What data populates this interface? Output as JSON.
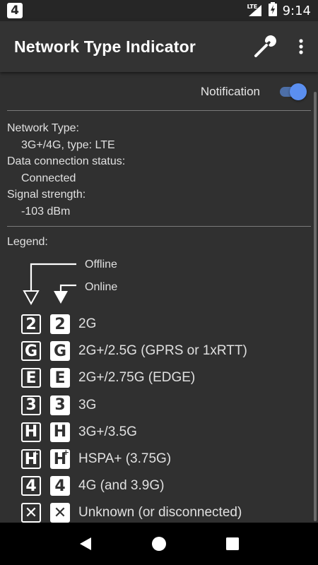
{
  "status_bar": {
    "notification_digit": "4",
    "network_label": "LTE",
    "time": "9:14"
  },
  "app_bar": {
    "title": "Network Type Indicator",
    "icons": [
      "wrench-icon",
      "more-vert-icon"
    ]
  },
  "settings": {
    "notification_label": "Notification",
    "notification_enabled": true,
    "switch_color": "#5b8ff0"
  },
  "info": {
    "network_type_label": "Network Type:",
    "network_type_value": "3G+/4G, type: LTE",
    "data_status_label": "Data connection status:",
    "data_status_value": "Connected",
    "signal_label": "Signal strength:",
    "signal_value": "-103 dBm"
  },
  "legend": {
    "title": "Legend:",
    "offline_label": "Offline",
    "online_label": "Online",
    "items": [
      {
        "symbol": "2",
        "sup": "",
        "label": "2G"
      },
      {
        "symbol": "G",
        "sup": "",
        "label": "2G+/2.5G (GPRS or 1xRTT)"
      },
      {
        "symbol": "E",
        "sup": "",
        "label": "2G+/2.75G (EDGE)"
      },
      {
        "symbol": "3",
        "sup": "",
        "label": "3G"
      },
      {
        "symbol": "H",
        "sup": "",
        "label": "3G+/3.5G"
      },
      {
        "symbol": "H",
        "sup": "+",
        "label": "HSPA+ (3.75G)"
      },
      {
        "symbol": "4",
        "sup": "",
        "label": "4G (and 3.9G)"
      },
      {
        "symbol": "✕",
        "sup": "",
        "label": "Unknown (or disconnected)"
      }
    ]
  },
  "nav_bar": {
    "icons": [
      "back-icon",
      "home-icon",
      "recents-icon"
    ]
  }
}
